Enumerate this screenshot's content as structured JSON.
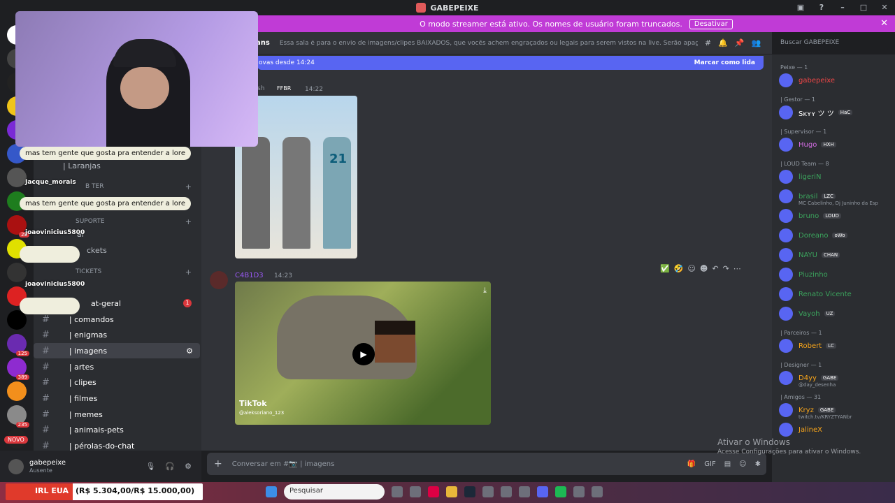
{
  "window": {
    "title": "GABEPEIXE"
  },
  "streamer_banner": {
    "text": "O modo streamer está ativo. Os nomes de usuário foram truncados.",
    "button": "Desativar"
  },
  "channel_header": {
    "name": "ans",
    "topic": "Essa sala é para o envio de imagens/clipes BAIXADOS, que vocês achem engraçados ou legais para serem vistos na live. Serão apagados prints de o...",
    "search_placeholder": "Buscar GABEPEIXE"
  },
  "new_messages": {
    "text": "ovas desde 14:24",
    "action": "Marcar como lida"
  },
  "messages": [
    {
      "author": "sh",
      "tag": "FFBR",
      "time": "14:22"
    },
    {
      "author": "C4B1D3",
      "time": "14:23",
      "tiktok_label": "TikTok",
      "tiktok_handle": "@aleksoriano_123",
      "image_number": "21"
    }
  ],
  "sidebar": {
    "categories": [
      {
        "label": "B  TER",
        "plus": "+"
      },
      {
        "label": "SUPORTE",
        "plus": "+"
      },
      {
        "label": "TICKETS",
        "plus": "+"
      }
    ],
    "partial_items": [
      "| Laranjas",
      "ckets",
      "al"
    ],
    "channels": [
      {
        "label": "at-geral",
        "unread": "1"
      },
      {
        "label": "| comandos"
      },
      {
        "label": "| enigmas"
      },
      {
        "label": "| imagens",
        "active": true
      },
      {
        "label": "| artes"
      },
      {
        "label": "| clipes"
      },
      {
        "label": "| filmes"
      },
      {
        "label": "| memes"
      },
      {
        "label": "| animais-pets"
      },
      {
        "label": "| pérolas-do-chat"
      }
    ]
  },
  "server_badges": {
    "b1": "28",
    "b2": "125",
    "b3": "389",
    "b4": "235",
    "novo": "NOVO"
  },
  "user_panel": {
    "name": "gabepeixe",
    "status": "Ausente"
  },
  "composer": {
    "placeholder": "Conversar em #📷 | imagens"
  },
  "members": {
    "groups": [
      {
        "label": "Peixe — 1",
        "members": [
          {
            "name": "gabepeixe",
            "color": "#f04747"
          }
        ]
      },
      {
        "label": "| Gestor — 1",
        "members": [
          {
            "name": "Sᴋʏʏ ツ ツ",
            "tag": "HaC",
            "color": "#ffffff"
          }
        ]
      },
      {
        "label": "| Supervisor — 1",
        "members": [
          {
            "name": "Hugo",
            "tag": "HXH",
            "color": "#d36ce3"
          }
        ]
      },
      {
        "label": "| LOUD Team — 8",
        "members": [
          {
            "name": "ligeriN",
            "color": "#3ba55d"
          },
          {
            "name": "brasil",
            "tag": "LZC",
            "sub": "MC Cabelinho, Dj Juninho da Esp",
            "color": "#3ba55d"
          },
          {
            "name": "bruno",
            "tag": "LOUD",
            "color": "#3ba55d"
          },
          {
            "name": "Doreano",
            "tag": "oWo",
            "color": "#3ba55d"
          },
          {
            "name": "NAYU",
            "tag": "CHAN",
            "color": "#3ba55d"
          },
          {
            "name": "Piuzinho",
            "color": "#3ba55d"
          },
          {
            "name": "Renato Vicente",
            "color": "#3ba55d"
          },
          {
            "name": "Vayoh",
            "tag": "UZ",
            "color": "#3ba55d"
          }
        ]
      },
      {
        "label": "| Parceiros — 1",
        "members": [
          {
            "name": "Robert",
            "tag": "LC",
            "color": "#faa61a"
          }
        ]
      },
      {
        "label": "| Designer — 1",
        "members": [
          {
            "name": "D4yy",
            "tag": "GABE",
            "sub": "@day_desenha",
            "color": "#faa61a"
          }
        ]
      },
      {
        "label": "| Amigos — 31",
        "members": [
          {
            "name": "Kryz",
            "tag": "GABE",
            "sub": "twitch.tv/KRYZTYANbr",
            "color": "#faa61a"
          },
          {
            "name": "JalineX",
            "color": "#faa61a"
          }
        ]
      }
    ]
  },
  "overlay_chat": [
    {
      "text": "mas tem gente que gosta pra entender a lore"
    },
    {
      "user": "Jacque_morais"
    },
    {
      "text": "mas tem gente que gosta pra entender a lore"
    },
    {
      "user": "joaovinicius5800"
    },
    {
      "user": "joaovinicius5800"
    }
  ],
  "bottom_bar": {
    "irl_label": "IRL EUA",
    "irl_value": "(R$ 5.304,00/R$ 15.000,00)",
    "search": "Pesquisar"
  },
  "windows_watermark": {
    "title": "Ativar o Windows",
    "sub": "Acesse Configurações para ativar o Windows."
  }
}
